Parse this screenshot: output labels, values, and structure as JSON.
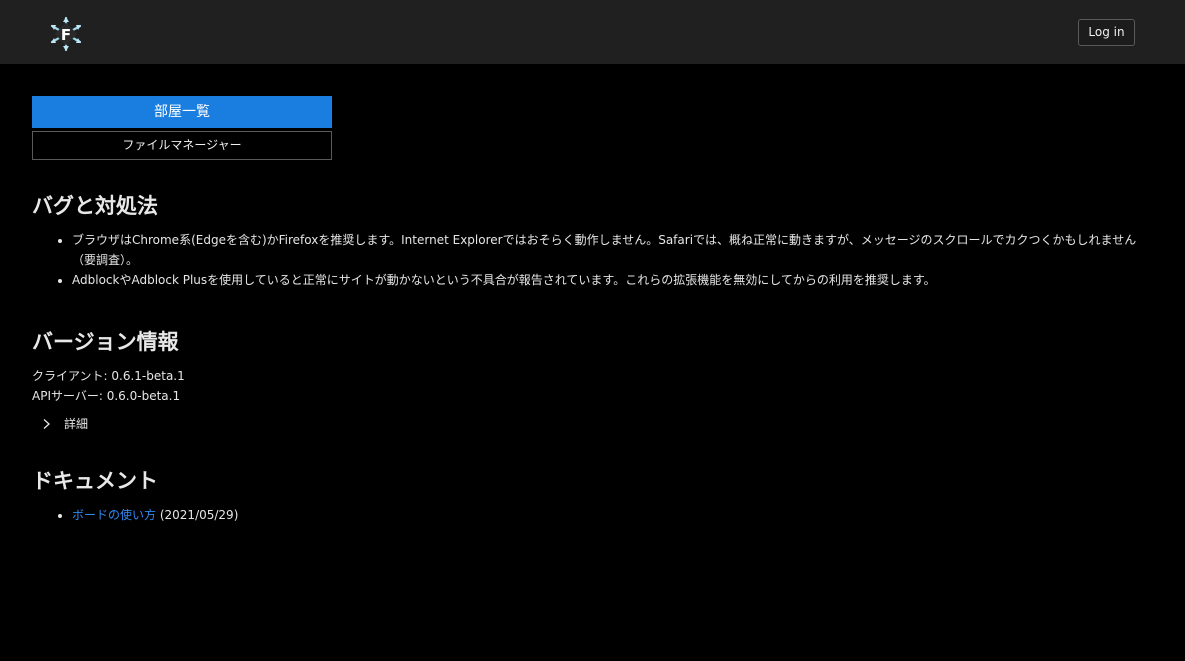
{
  "header": {
    "logo_icon": "snowflake-f-logo",
    "login_label": "Log in"
  },
  "nav": {
    "rooms_label": "部屋一覧",
    "files_label": "ファイルマネージャー",
    "accent_color": "#1a7de0"
  },
  "bugs": {
    "title": "バグと対処法",
    "items": [
      "ブラウザはChrome系(Edgeを含む)かFirefoxを推奨します。Internet Explorerではおそらく動作しません。Safariでは、概ね正常に動きますが、メッセージのスクロールでカクつくかもしれません（要調査）。",
      "AdblockやAdblock Plusを使用していると正常にサイトが動かないという不具合が報告されています。これらの拡張機能を無効にしてからの利用を推奨します。"
    ]
  },
  "version": {
    "title": "バージョン情報",
    "client": "クライアント: 0.6.1-beta.1",
    "api": "APIサーバー: 0.6.0-beta.1",
    "details_label": "詳細"
  },
  "docs": {
    "title": "ドキュメント",
    "items": [
      {
        "link": "ボードの使い方",
        "date": "(2021/05/29)"
      }
    ],
    "link_color": "#2f88f0"
  }
}
